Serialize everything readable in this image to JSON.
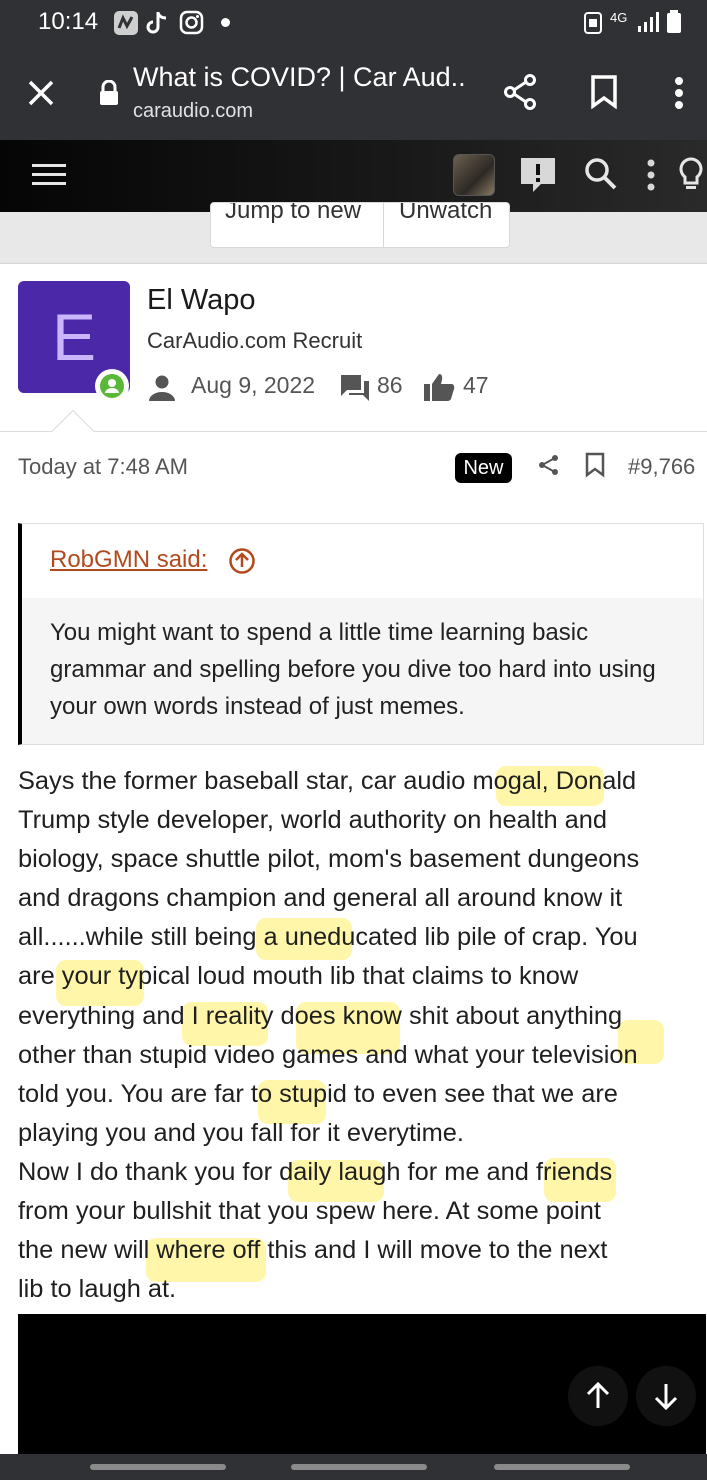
{
  "status_bar": {
    "time": "10:14",
    "network_label": "4G"
  },
  "browser": {
    "tab_title": "What is COVID? | Car Aud...",
    "domain": "caraudio.com"
  },
  "thread_buttons": {
    "jump": "Jump to new",
    "watch": "Unwatch"
  },
  "user": {
    "avatar_letter": "E",
    "name": "El Wapo",
    "title": "CarAudio.com Recruit",
    "joined": "Aug 9, 2022",
    "messages": "86",
    "reactions": "47"
  },
  "post": {
    "time": "Today at 7:48 AM",
    "badge": "New",
    "number": "#9,766"
  },
  "quote": {
    "author": "RobGMN said:",
    "text": "You might want to spend a little time learning basic grammar and spelling before you dive too hard into using your own words instead of just memes."
  },
  "message": "Says the former baseball star, car audio mogal, Donald\nTrump style developer, world authority on health and\nbiology, space shuttle pilot, mom's basement dungeons\nand dragons champion and general all around know it\nall......while still being a uneducated lib pile of crap. You\nare your typical loud mouth lib that claims to know\neverything and I reality does know shit about anything\nother than stupid video games and what your television\ntold you. You are far to stupid to even see that we are\nplaying you and you fall for it everytime.\nNow I do thank you for daily laugh for me and friends\nfrom your bullshit that you spew here. At some point\nthe new will where off this and I will move to the next\nlib to laugh at.",
  "colors": {
    "avatar_bg": "#4a28a8",
    "online": "#59b837",
    "quote_author": "#b24a1e",
    "highlight": "#ffec40"
  }
}
